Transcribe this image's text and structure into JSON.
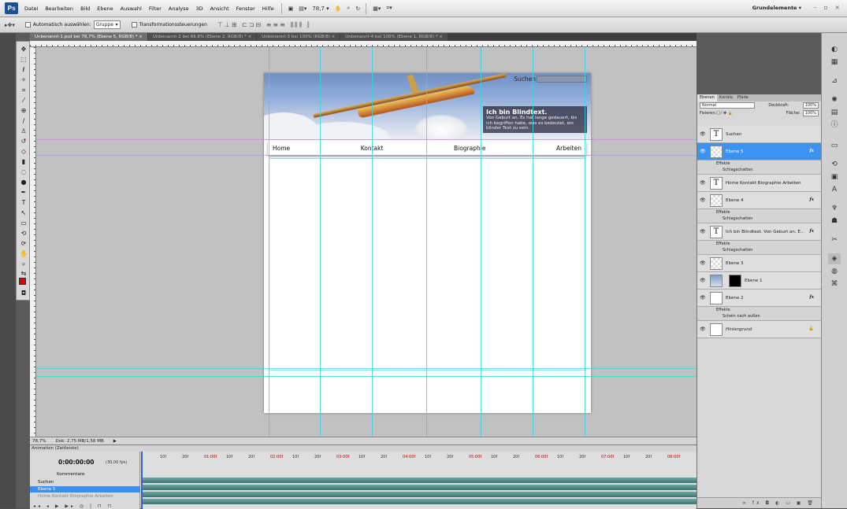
{
  "app": {
    "logo": "Ps",
    "menu": [
      "Datei",
      "Bearbeiten",
      "Bild",
      "Ebene",
      "Auswahl",
      "Filter",
      "Analyse",
      "3D",
      "Ansicht",
      "Fenster",
      "Hilfe"
    ],
    "zoom_value": "78,7",
    "workspace": "Grundelemente",
    "window_controls": "– ▫ ×"
  },
  "options": {
    "auto_select_label": "Automatisch auswählen:",
    "auto_select_value": "Gruppe",
    "transform_label": "Transformationssteuerungen"
  },
  "tabs": [
    "Unbenannt-1.psd bei 78,7% (Ebene 5, RGB/8) * ×",
    "Unbenannt-2 bei 66,8% (Ebene 2, RGB/8) * ×",
    "Unbenannt-3 bei 100% (RGB/8) ×",
    "Unbenannt-4 bei 100% (Ebene 1, RGB/8) * ×"
  ],
  "document": {
    "search_label": "Suchen",
    "info_title": "Ich bin Blindtext.",
    "info_text": "Von Geburt an. Es hat lange gedauert, bis ich begriffen habe, was es bedeutet, ein blinder Text zu sein.",
    "nav": [
      "Home",
      "Kontakt",
      "Biographie",
      "Arbeiten"
    ]
  },
  "status": {
    "zoom": "78,7%",
    "doc_info": "Dok: 2,75 MB/1,56 MB"
  },
  "animation": {
    "title": "Animation (Zeitleiste)",
    "timecode": "0:00:00:00",
    "fps": "(30,00 fps)",
    "rows": [
      "Kommentare",
      "Suchen",
      "Ebene 5",
      "Home Kontakt Biographie Arbeiten"
    ],
    "ticks": [
      "10f",
      "20f",
      "01:00f",
      "10f",
      "20f",
      "02:00f",
      "10f",
      "20f",
      "03:00f",
      "10f",
      "20f",
      "04:00f",
      "10f",
      "20f",
      "05:00f",
      "10f",
      "20f",
      "06:00f",
      "10f",
      "20f",
      "07:00f",
      "10f",
      "20f",
      "08:00f"
    ]
  },
  "layers_panel": {
    "tabs": [
      "Ebenen",
      "Kanäle",
      "Pfade"
    ],
    "blend_mode": "Normal",
    "opacity_label": "Deckkraft:",
    "opacity_value": "100%",
    "lock_label": "Fixieren:",
    "fill_label": "Fläche:",
    "fill_value": "100%",
    "effects_label": "Effekte",
    "drop_shadow": "Schlagschatten",
    "outer_glow": "Schein nach außen",
    "layers": [
      {
        "name": "Suchen",
        "thumb": "T"
      },
      {
        "name": "Ebene 5",
        "thumb": ""
      },
      {
        "name": "Home Kontakt Biographie Arbeiten",
        "thumb": "T"
      },
      {
        "name": "Ebene 4",
        "thumb": ""
      },
      {
        "name": "Ich bin Blindtext.  Von Geburt an. E...",
        "thumb": "T"
      },
      {
        "name": "Ebene 3",
        "thumb": ""
      },
      {
        "name": "Ebene 1",
        "thumb": ""
      },
      {
        "name": "Ebene 2",
        "thumb": ""
      },
      {
        "name": "Hintergrund",
        "thumb": ""
      }
    ],
    "fx_label": "fx"
  },
  "colors": {
    "foreground": "#e00000",
    "selection": "#3c92f0",
    "guides": "#36d3e6"
  }
}
